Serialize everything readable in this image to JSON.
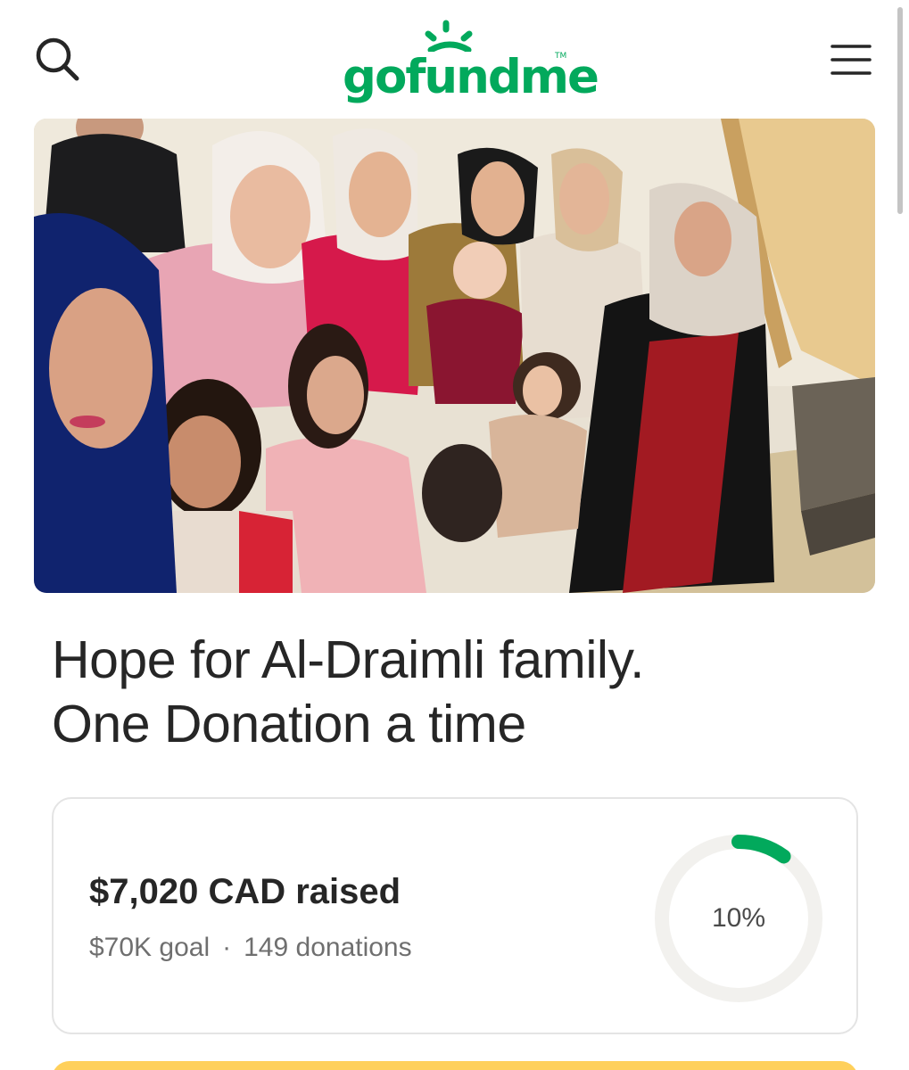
{
  "header": {
    "logo_text": "gofundme",
    "logo_tm": "TM",
    "brand_color": "#02a95c",
    "search_icon": "search-icon",
    "menu_icon": "hamburger-menu-icon"
  },
  "campaign": {
    "title_line1": "Hope for Al-Draimli family.",
    "title_line2": "One Donation a time",
    "hero_image": "family-group-photo"
  },
  "progress": {
    "raised": "$7,020 CAD raised",
    "goal": "$70K goal",
    "separator": "·",
    "donations": "149 donations",
    "percent_label": "10%",
    "percent_value": 0.1,
    "ring_track_color": "#f2f1ee",
    "ring_fill_color": "#02a95c"
  },
  "donate_button_color": "#ffd05b"
}
